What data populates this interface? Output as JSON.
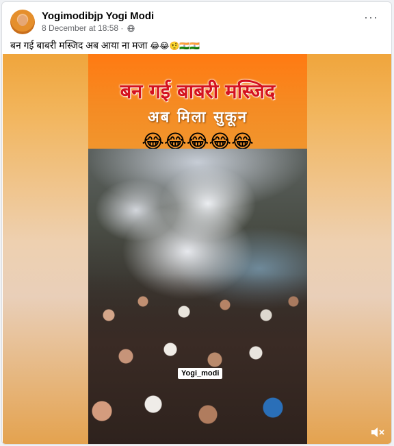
{
  "post": {
    "author": "Yogimodibjp Yogi Modi",
    "timestamp": "8 December at 18:58",
    "separator": "·",
    "caption_text": "बन गई बाबरी मस्जिद अब आया ना मजा",
    "caption_emojis": "😂😂🤨🇮🇳🇮🇳",
    "more_label": "···"
  },
  "video": {
    "banner_title": "बन गई बाबरी मस्जिद",
    "banner_subtitle": "अब मिला सुकून",
    "banner_emojis": "😂😂😂😂😂",
    "watermark": "Yogi_modi"
  },
  "icons": {
    "privacy": "globe-icon",
    "more": "more-options-icon",
    "volume": "volume-muted-icon"
  },
  "colors": {
    "card_bg": "#ffffff",
    "page_bg": "#f0f2f5",
    "banner_orange": "#ff7a12",
    "banner_title_red": "#d4121f",
    "meta_gray": "#65676b"
  }
}
